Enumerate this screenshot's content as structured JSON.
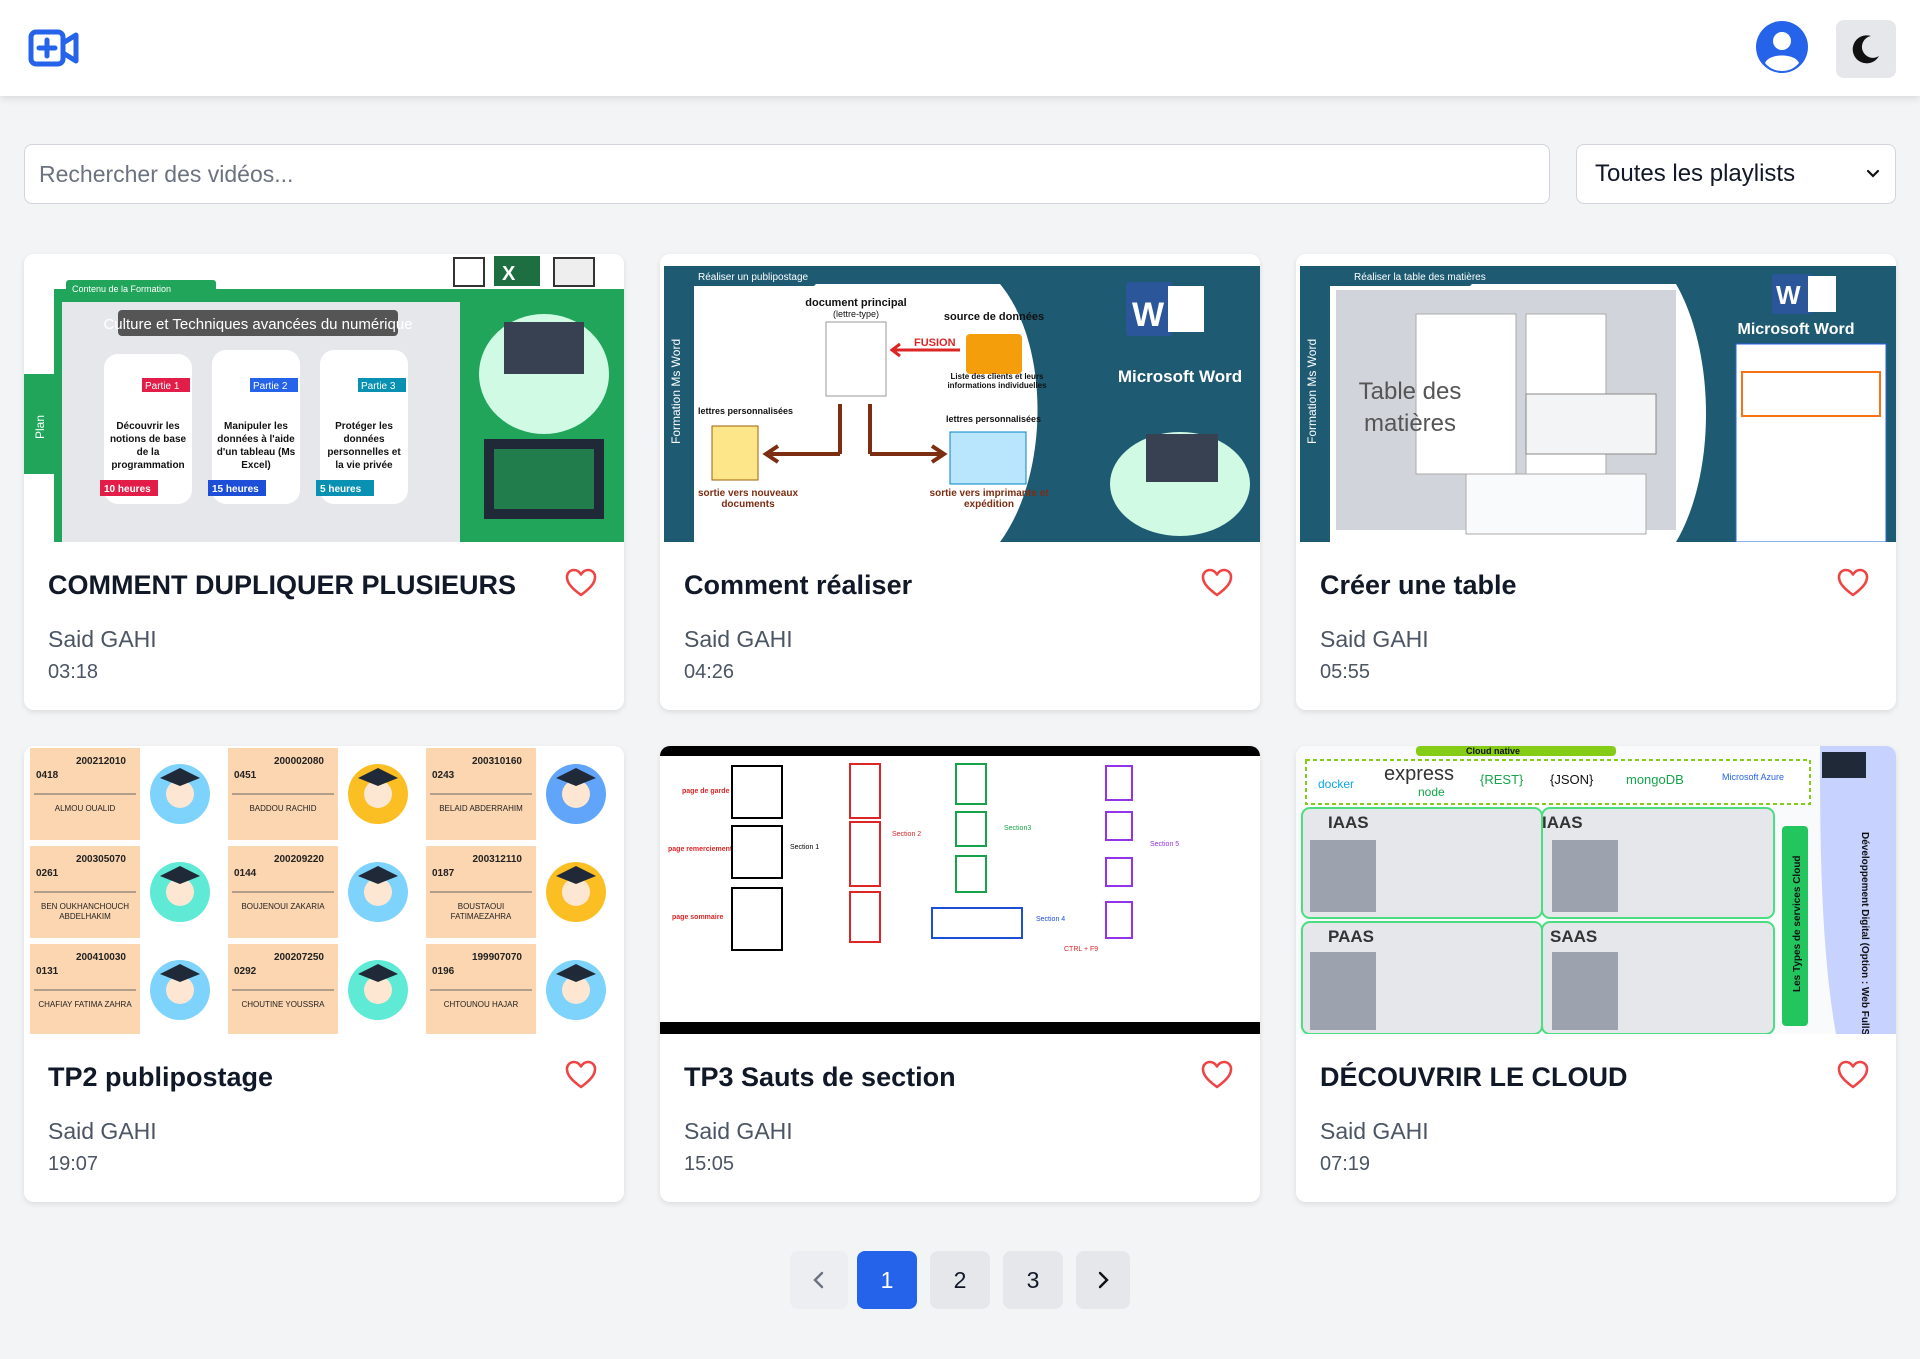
{
  "header": {
    "logo_icon": "video-plus-icon",
    "profile_icon": "user-circle-icon",
    "theme_icon": "moon-icon",
    "accent": "#2563eb"
  },
  "filters": {
    "search_placeholder": "Rechercher des vidéos...",
    "playlist_selected": "Toutes les playlists",
    "chevron_icon": "chevron-down-icon"
  },
  "videos": [
    {
      "title": "COMMENT DUPLIQUER PLUSIEURS",
      "author": "Said GAHI",
      "duration": "03:18",
      "favorite_icon": "heart-outline-icon"
    },
    {
      "title": "Comment réaliser",
      "author": "Said GAHI",
      "duration": "04:26",
      "favorite_icon": "heart-outline-icon"
    },
    {
      "title": "Créer une table",
      "author": "Said GAHI",
      "duration": "05:55",
      "favorite_icon": "heart-outline-icon"
    },
    {
      "title": "TP2 publipostage",
      "author": "Said GAHI",
      "duration": "19:07",
      "favorite_icon": "heart-outline-icon"
    },
    {
      "title": "TP3 Sauts de section",
      "author": "Said GAHI",
      "duration": "15:05",
      "favorite_icon": "heart-outline-icon"
    },
    {
      "title": "DÉCOUVRIR LE CLOUD",
      "author": "Said GAHI",
      "duration": "07:19",
      "favorite_icon": "heart-outline-icon"
    }
  ],
  "thumbnails": {
    "t1": {
      "tag": "Contenu de la Formation",
      "side": "Plan",
      "banner": "Culture et Techniques avancées du numérique",
      "parts": [
        {
          "label": "Partie 1",
          "text": "Découvrir les notions de base de la programmation",
          "hours": "10 heures"
        },
        {
          "label": "Partie 2",
          "text": "Manipuler les données à l'aide d'un tableau (Ms Excel)",
          "hours": "15 heures"
        },
        {
          "label": "Partie 3",
          "text": "Protéger les données personnelles et la vie privée",
          "hours": "5 heures"
        }
      ]
    },
    "t2": {
      "tag": "Réaliser un publipostage",
      "side": "Formation Ms Word",
      "brand": "Microsoft Word",
      "doc_main": "document principal",
      "doc_type": "(lettre-type)",
      "source": "source de données",
      "fusion": "FUSION",
      "clients": "Liste des clients et leurs informations individuelles",
      "letters": "lettres personnalisées",
      "out_left": "sortie vers nouveaux documents",
      "out_right": "sortie vers imprimante et expédition"
    },
    "t3": {
      "tag": "Réaliser la table des matières",
      "side": "Formation Ms Word",
      "brand": "Microsoft Word",
      "big": "Table des matières"
    },
    "t4": {
      "people": [
        {
          "id": "200212010",
          "num": "0418",
          "name": "ALMOU OUALID"
        },
        {
          "id": "200002080",
          "num": "0451",
          "name": "BADDOU RACHID"
        },
        {
          "id": "200310160",
          "num": "0243",
          "name": "BELAID ABDERRAHIM"
        },
        {
          "id": "200305070",
          "num": "0261",
          "name": "BEN OUKHANCHOUCH ABDELHAKIM"
        },
        {
          "id": "200209220",
          "num": "0144",
          "name": "BOUJENOUI ZAKARIA"
        },
        {
          "id": "200312110",
          "num": "0187",
          "name": "BOUSTAOUI FATIMAEZAHRA"
        },
        {
          "id": "200410030",
          "num": "0131",
          "name": "CHAFIAY FATIMA ZAHRA"
        },
        {
          "id": "200207250",
          "num": "0292",
          "name": "CHOUTINE YOUSSRA"
        },
        {
          "id": "199907070",
          "num": "0196",
          "name": "CHTOUNOU HAJAR"
        }
      ]
    },
    "t5": {
      "garde": "page de garde",
      "remerciement": "page remerciement",
      "sommaire": "page sommaire",
      "s1": "Section 1",
      "s2": "Section 2",
      "s3": "Section3",
      "s4": "Section 4",
      "s5": "Section 5",
      "shortcut": "CTRL + F9"
    },
    "t6": {
      "top": "Cloud native",
      "logos": [
        "docker",
        "express",
        "node",
        "{REST}",
        "{JSON}",
        "mongoDB",
        "Microsoft Azure"
      ],
      "iaas": "IAAS",
      "paas": "PAAS",
      "saas": "SAAS",
      "side": "Les Types de services Cloud",
      "vertical": "Développement Digital (Option : Web FullStack)"
    }
  },
  "pagination": {
    "prev_icon": "chevron-left-icon",
    "next_icon": "chevron-right-icon",
    "pages": [
      "1",
      "2",
      "3"
    ],
    "current": "1"
  }
}
